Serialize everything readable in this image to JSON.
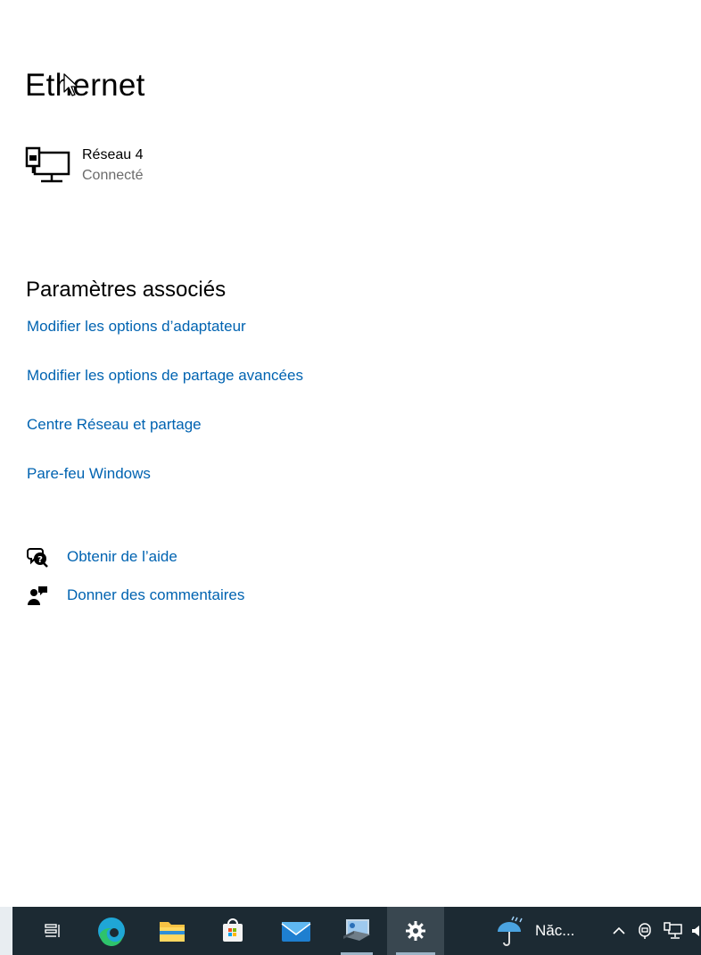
{
  "page": {
    "title": "Ethernet"
  },
  "network": {
    "name": "Réseau 4",
    "status": "Connecté"
  },
  "related": {
    "heading": "Paramètres associés",
    "links": [
      "Modifier les options d’adaptateur",
      "Modifier les options de partage avancées",
      "Centre Réseau et partage",
      "Pare-feu Windows"
    ]
  },
  "help": {
    "get_help": "Obtenir de l’aide",
    "feedback": "Donner des commentaires"
  },
  "taskbar": {
    "apps": [
      "task-view-icon",
      "edge-icon",
      "file-explorer-icon",
      "store-icon",
      "mail-icon",
      "remote-desktop-icon",
      "settings-icon"
    ],
    "active_app": "settings-icon",
    "weather_text": "Năc...",
    "tray_icons": [
      "chevron-up-icon",
      "meet-now-icon",
      "network-icon"
    ]
  },
  "colors": {
    "link": "#0063b1",
    "taskbar": "#1c2a33",
    "status": "#6b6b6b"
  }
}
